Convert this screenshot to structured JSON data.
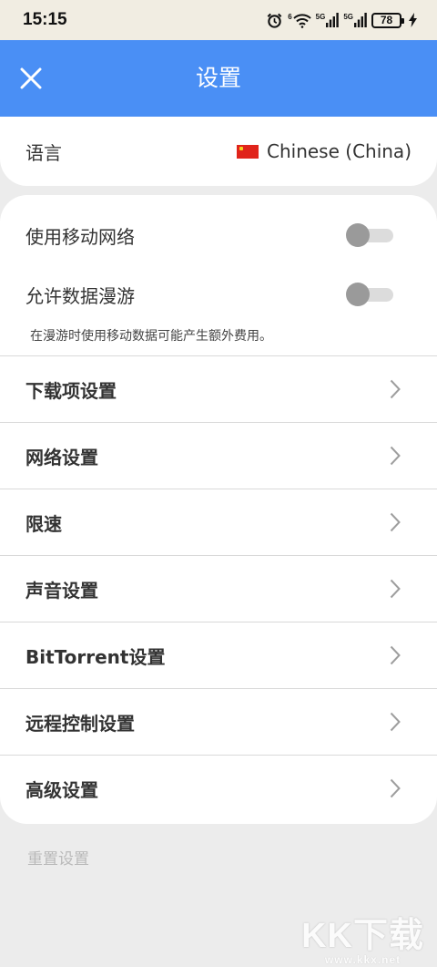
{
  "status_bar": {
    "time": "15:15",
    "net1": "5G",
    "net2": "5G",
    "battery": "78",
    "icons": [
      "alarm-icon",
      "wifi-icon",
      "signal-icon",
      "signal-icon",
      "battery-icon",
      "charging-icon"
    ]
  },
  "header": {
    "title": "设置",
    "close_icon": "close-icon",
    "accent": "#4a8ff5"
  },
  "language": {
    "label": "语言",
    "value": "Chinese (China)",
    "flag_icon": "china-flag-icon"
  },
  "toggles": [
    {
      "label": "使用移动网络",
      "on": false
    },
    {
      "label": "允许数据漫游",
      "on": false
    }
  ],
  "roaming_note": "在漫游时使用移动数据可能产生额外费用。",
  "menu": [
    {
      "label": "下载项设置"
    },
    {
      "label": "网络设置"
    },
    {
      "label": "限速"
    },
    {
      "label": "声音设置"
    },
    {
      "label": "BitTorrent设置"
    },
    {
      "label": "远程控制设置"
    },
    {
      "label": "高级设置"
    }
  ],
  "reset_label": "重置设置",
  "watermark": {
    "logo": "KK下载",
    "url": "www.kkx.net"
  }
}
